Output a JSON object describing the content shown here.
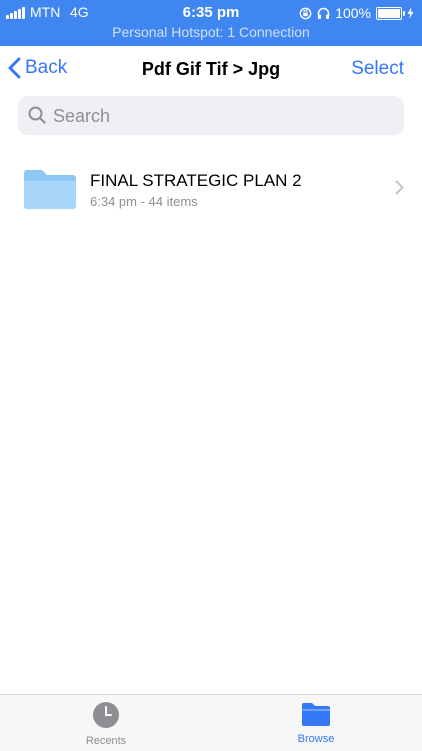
{
  "status_bar": {
    "carrier": "MTN",
    "network": "4G",
    "time": "6:35 pm",
    "battery_percent_text": "100%",
    "battery_level": 1.0,
    "hotspot_text": "Personal Hotspot: 1 Connection",
    "icons": [
      "signal-icon",
      "orientation-lock-icon",
      "headphones-icon",
      "battery-icon",
      "charging-bolt-icon"
    ]
  },
  "nav": {
    "back_label": "Back",
    "title": "Pdf Gif Tif > Jpg",
    "select_label": "Select"
  },
  "search": {
    "placeholder": "Search",
    "value": ""
  },
  "items": [
    {
      "name": "FINAL STRATEGIC PLAN 2",
      "meta": "6:34 pm - 44 items",
      "icon": "folder-icon"
    }
  ],
  "tabs": [
    {
      "label": "Recents",
      "icon": "clock-icon",
      "active": false
    },
    {
      "label": "Browse",
      "icon": "folder-icon",
      "active": true
    }
  ],
  "colors": {
    "status_bar_bg": "#3f86f0",
    "accent": "#3478f6",
    "folder": "#8cc8f5",
    "secondary_text": "#8e8e93"
  }
}
